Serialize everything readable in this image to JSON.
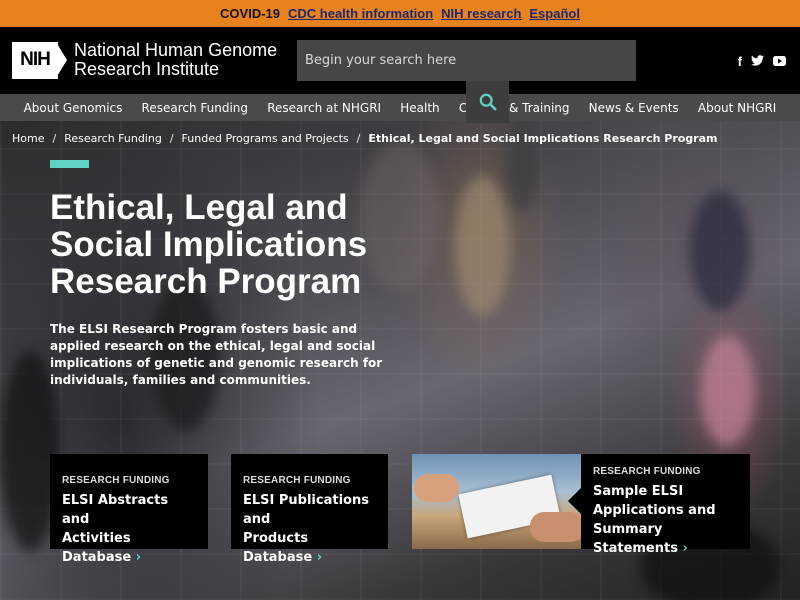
{
  "alert": {
    "label": "COVID-19",
    "links": [
      "CDC health information",
      "NIH research",
      "Español"
    ]
  },
  "header": {
    "logo_text": "NIH",
    "org_line1": "National Human Genome",
    "org_line2": "Research Institute",
    "search_placeholder": "Begin your search here",
    "social": [
      "f",
      "🐦",
      "▶"
    ]
  },
  "nav": [
    "About Genomics",
    "Research Funding",
    "Research at NHGRI",
    "Health",
    "Careers & Training",
    "News & Events",
    "About NHGRI"
  ],
  "breadcrumb": [
    "Home",
    "Research Funding",
    "Funded Programs and Projects",
    "Ethical, Legal and Social Implications Research Program"
  ],
  "hero": {
    "title_lines": [
      "Ethical, Legal and",
      "Social Implications",
      "Research Program"
    ],
    "intro": "The ELSI Research Program fosters basic and applied research on the ethical, legal and social implications of genetic and genomic research for individuals, families and communities."
  },
  "cards": [
    {
      "eyebrow": "RESEARCH FUNDING",
      "line1": "ELSI Abstracts and",
      "line2": "Activities Database"
    },
    {
      "eyebrow": "RESEARCH FUNDING",
      "line1": "ELSI Publications and",
      "line2": "Products Database"
    },
    {
      "eyebrow": "RESEARCH FUNDING",
      "line1": "Sample ELSI",
      "line2": "Applications and",
      "line3": "Summary Statements"
    }
  ],
  "colors": {
    "alert": "#e8821c",
    "accent": "#5fd3c6",
    "link": "#20286e"
  }
}
